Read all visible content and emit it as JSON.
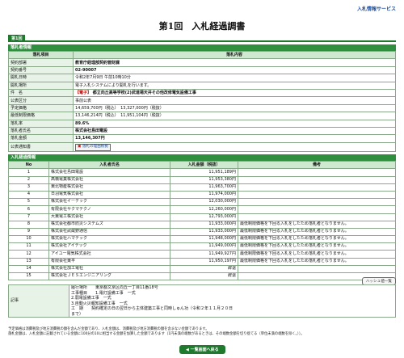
{
  "header": {
    "service_link": "入札情報サービス",
    "page_title": "第1回　入札経過調書",
    "round_tag": "第1回"
  },
  "info": {
    "section_title": "落札者情報",
    "col_item": "落札項目",
    "col_content": "落札内容",
    "rows": {
      "dept_label": "契約部署",
      "dept_value": "教育庁経理部契約管財課",
      "contract_no_label": "契約番号",
      "contract_no_value": "02-90007",
      "open_datetime_label": "開札日時",
      "open_datetime_value": "令和2年7月9日 午前10時10分",
      "open_place_label": "開札場所",
      "open_place_value": "電子入札システムにより開札を行います。",
      "subject_label": "件　名",
      "subject_tag": "【電子】",
      "subject_value": "都立向丘高等学校(2)武道場天井その他改修電気設備工事",
      "method_label": "公表区分",
      "method_value": "事前公表",
      "planned_price_label": "予定価格",
      "planned_price_value": "14,659,700円（税込）　13,327,000円（税抜）",
      "min_price_label": "最低制限価格",
      "min_price_value": "13,146,214円（税込）　11,951,104円（税抜）",
      "rate_label": "落札率",
      "rate_value": "89.6%",
      "winner_label": "落札者氏名",
      "winner_value": "株式会社島田電設",
      "amount_label": "落札金額",
      "amount_value": "13,146,307円",
      "notice_label": "公表通知書",
      "notice_button": "落札の理由根拠"
    }
  },
  "bidders": {
    "section_title": "入札経過情報",
    "col_no": "No",
    "col_name": "入札者氏名",
    "col_amount": "入札金額（税抜）",
    "col_note": "備考",
    "rows": [
      {
        "no": "1",
        "name": "株式会社島田電設",
        "amount": "11,951,189円",
        "note": ""
      },
      {
        "no": "2",
        "name": "髙橋電業株式会社",
        "amount": "11,953,380円",
        "note": ""
      },
      {
        "no": "3",
        "name": "東北物産株式会社",
        "amount": "11,963,700円",
        "note": ""
      },
      {
        "no": "4",
        "name": "日羽電気株式会社",
        "amount": "11,974,000円",
        "note": ""
      },
      {
        "no": "5",
        "name": "株式会社イーテック",
        "amount": "12,030,000円",
        "note": ""
      },
      {
        "no": "6",
        "name": "有限会社サクマテクノ",
        "amount": "12,260,000円",
        "note": ""
      },
      {
        "no": "7",
        "name": "大東電工株式会社",
        "amount": "12,793,000円",
        "note": ""
      },
      {
        "no": "8",
        "name": "株式会社都市防災システムズ",
        "amount": "11,933,000円",
        "note": "最低制限価格を下回る入札をしたため落札者となりません。"
      },
      {
        "no": "9",
        "name": "株式会社武蔵野通信",
        "amount": "11,933,000円",
        "note": "最低制限価格を下回る入札をしたため落札者となりません。"
      },
      {
        "no": "10",
        "name": "株式会社ハマテック",
        "amount": "11,948,000円",
        "note": "最低制限価格を下回る入札をしたため落札者となりません。"
      },
      {
        "no": "11",
        "name": "株式会社アイテック",
        "amount": "11,949,000円",
        "note": "最低制限価格を下回る入札をしたため落札者となりません。"
      },
      {
        "no": "12",
        "name": "アイユー電気株式会社",
        "amount": "11,949,927円",
        "note": "最低制限価格を下回る入札をしたため落札者となりません。"
      },
      {
        "no": "13",
        "name": "有限会社東平",
        "amount": "11,950,197円",
        "note": "最低制限価格を下回る入札をしたため落札者となりません。"
      },
      {
        "no": "14",
        "name": "株式会社加工電社",
        "amount": "辞退",
        "note": ""
      },
      {
        "no": "15",
        "name": "株式会社ＪＥＳエンジニアリング",
        "amount": "辞退",
        "note": ""
      }
    ]
  },
  "hash_button": "ハッシュ値一覧",
  "notes": {
    "label": "記事",
    "line1": "履行場所　　東京都文京区向丘一丁目11番18号",
    "line2": "工事種目　　1.電灯設備工事　一式",
    "line3": "2.弱電設備工事　一式",
    "line4": "3.自動火災報知設備工事　一式",
    "line5": "工　期　　契約確定の日の翌日から主体建築工事と同時しゅん功（令和２年１１月２０日",
    "line6": "まで）"
  },
  "footnote": {
    "line1": "予定価格は消費税及び地方消費税の額を含んだ金額であり、入札金額は、消費税及び地方消費税の額を含まない金額であります。",
    "line2": "落札金額は、入札金額に記載されている金額に100分の10に相当する金額を加算した金額であります（1円未満の端数があるときは、その端数金額を切り捨てる（単位未満の端数を除く。））。"
  },
  "back_button": "◀ 一覧画面へ戻る",
  "colors": {
    "accent_green": "#2f8f3f",
    "header_band": "#cfe8d0",
    "link_blue": "#1b4f9c",
    "alert_red": "#c00000"
  }
}
